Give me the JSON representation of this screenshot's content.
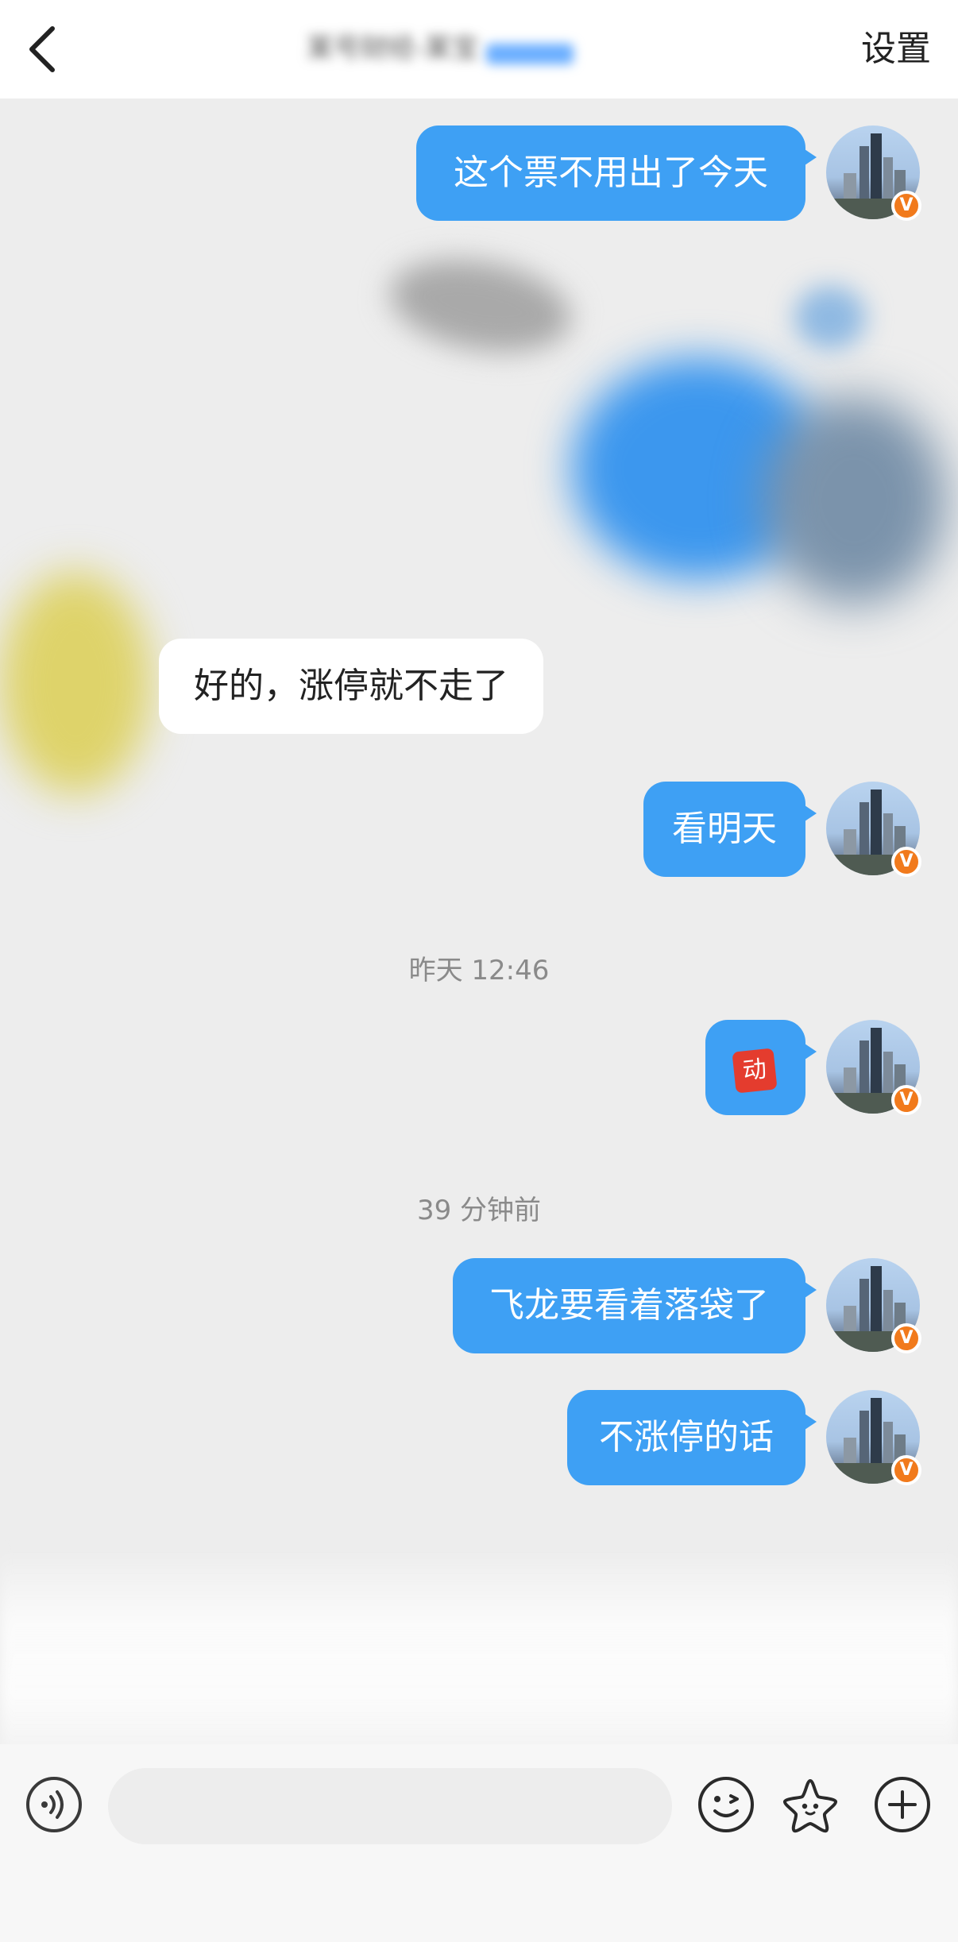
{
  "header": {
    "title": "某号财经-某宝",
    "settings_label": "设置"
  },
  "messages": [
    {
      "text": "这个票不用出了今天"
    },
    {
      "text": "好的，涨停就不走了"
    },
    {
      "text": "看明天"
    },
    {
      "timestamp": "昨天 12:46"
    },
    {
      "sticker": "动"
    },
    {
      "timestamp": "39 分钟前"
    },
    {
      "text": "飞龙要看着落袋了"
    },
    {
      "text": "不涨停的话"
    }
  ],
  "avatar_badge": "V",
  "input": {
    "placeholder": ""
  },
  "icons": {
    "back": "chevron-left-icon",
    "voice": "voice-icon",
    "emoji": "emoji-icon",
    "favorite": "star-icon",
    "more": "plus-icon"
  },
  "colors": {
    "outgoing_bubble": "#3ea0f4",
    "incoming_bubble": "#ffffff",
    "badge": "#f17a1c"
  }
}
